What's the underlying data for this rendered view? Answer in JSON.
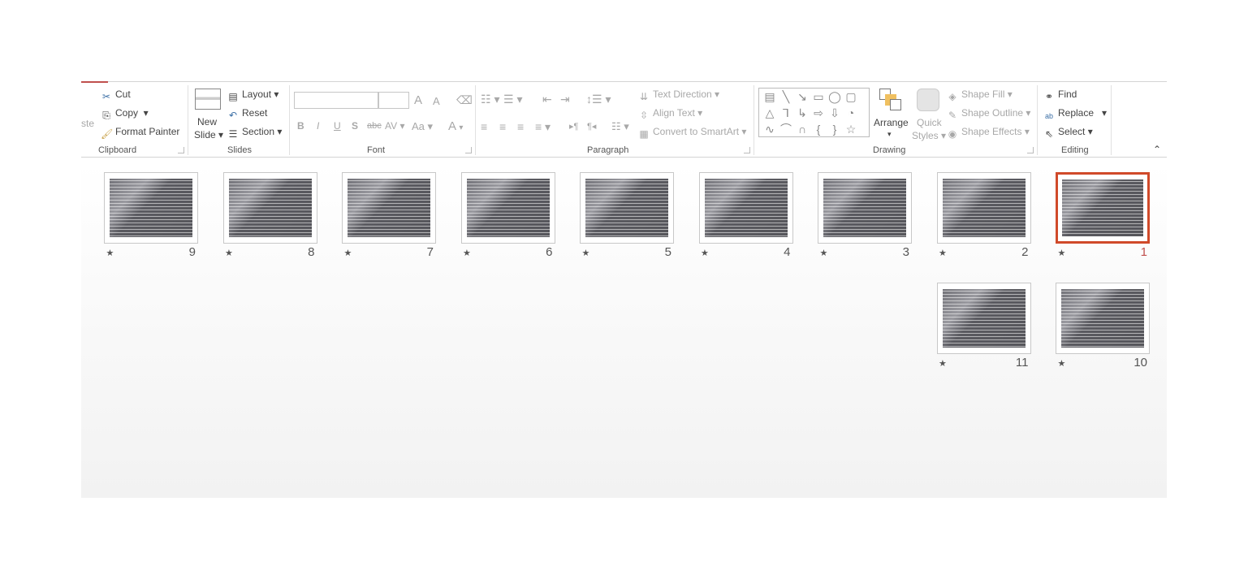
{
  "ribbon": {
    "clipboard": {
      "paste": "ste",
      "cut": "Cut",
      "copy": "Copy",
      "format_painter": "Format Painter",
      "label": "Clipboard"
    },
    "slides": {
      "new_slide_1": "New",
      "new_slide_2": "Slide",
      "layout": "Layout",
      "reset": "Reset",
      "section": "Section",
      "label": "Slides"
    },
    "font": {
      "label": "Font",
      "bold": "B",
      "italic": "I",
      "underline": "U",
      "shadow": "S",
      "strike": "abc",
      "spacing": "AV",
      "case": "Aa",
      "color": "A",
      "grow": "A",
      "shrink": "A"
    },
    "paragraph": {
      "label": "Paragraph",
      "text_direction": "Text Direction",
      "align_text": "Align Text",
      "smartart": "Convert to SmartArt"
    },
    "drawing": {
      "label": "Drawing",
      "arrange": "Arrange",
      "quick_1": "Quick",
      "quick_2": "Styles",
      "shape_fill": "Shape Fill",
      "shape_outline": "Shape Outline",
      "shape_effects": "Shape Effects"
    },
    "editing": {
      "label": "Editing",
      "find": "Find",
      "replace": "Replace",
      "select": "Select"
    }
  },
  "slides": [
    {
      "number": "1",
      "selected": true
    },
    {
      "number": "2"
    },
    {
      "number": "3"
    },
    {
      "number": "4"
    },
    {
      "number": "5"
    },
    {
      "number": "6"
    },
    {
      "number": "7"
    },
    {
      "number": "8"
    },
    {
      "number": "9"
    },
    {
      "number": "10"
    },
    {
      "number": "11"
    }
  ],
  "colors": {
    "selection": "#d04a2a",
    "accent": "#c0504d"
  }
}
